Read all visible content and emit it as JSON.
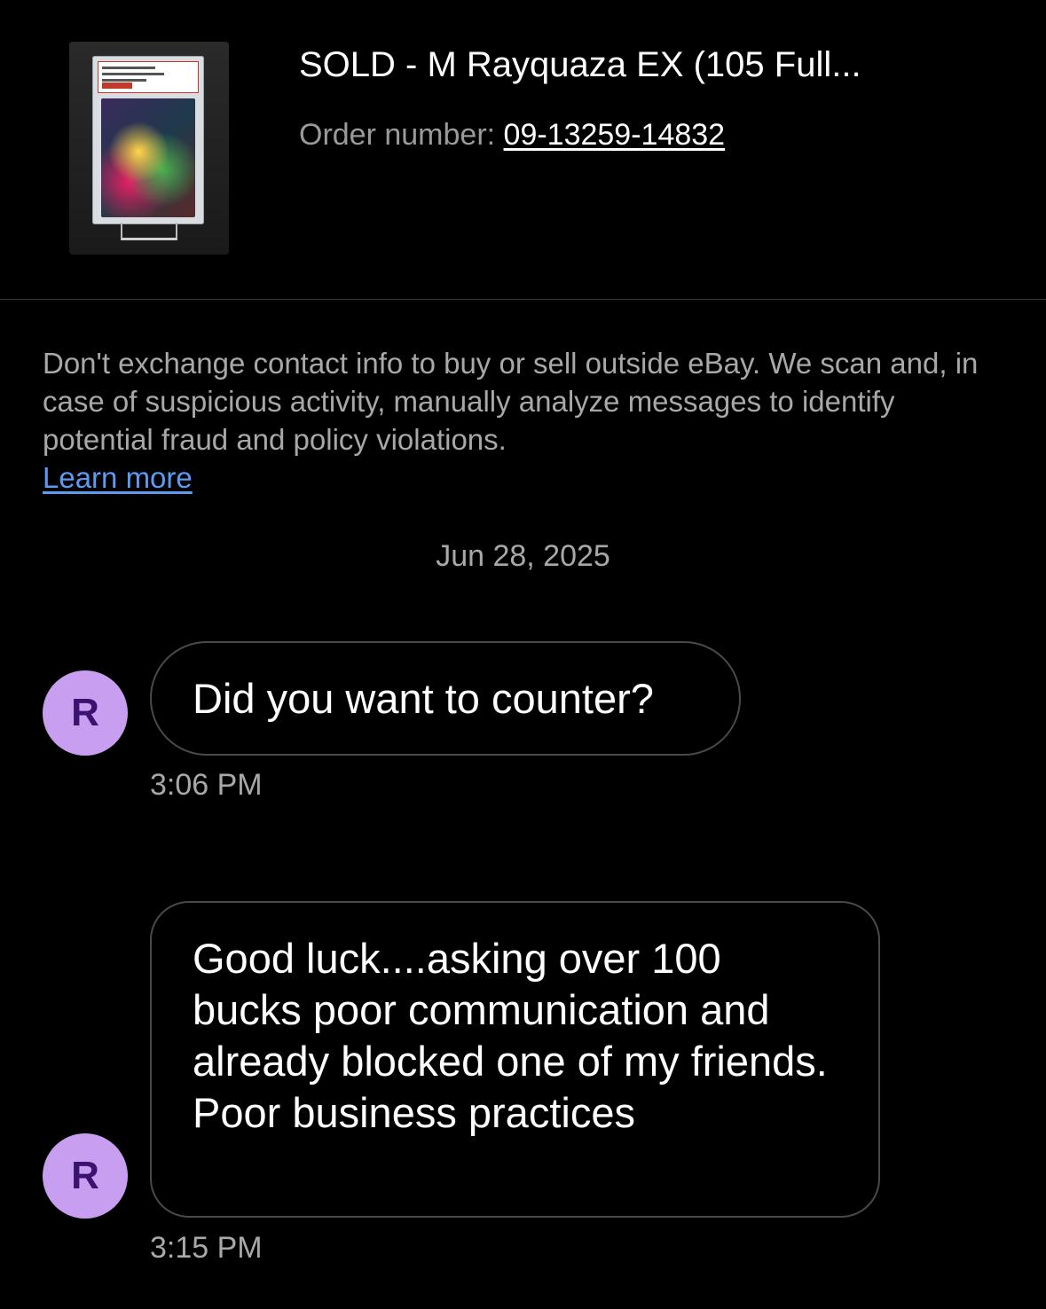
{
  "listing": {
    "title": "SOLD - M Rayquaza EX (105 Full...",
    "order_label": "Order number: ",
    "order_number": "09-13259-14832",
    "image_icon": "graded-card-photo"
  },
  "notice": {
    "text": "Don't exchange contact info to buy or sell outside eBay. We scan and, in case of suspicious activity, manually analyze messages to identify potential fraud and policy violations.",
    "link": "Learn more",
    "link_color": "#5b9cf2"
  },
  "date_separator": "Jun 28, 2025",
  "messages": [
    {
      "avatar_letter": "R",
      "text": "Did you want to counter?",
      "time": "3:06 PM"
    },
    {
      "avatar_letter": "R",
      "text": "Good luck....asking over 100 bucks poor communication and already blocked one of my friends. Poor business practices",
      "time": "3:15 PM"
    }
  ],
  "colors": {
    "background": "#000000",
    "avatar_bg": "#c89ff0",
    "avatar_text": "#3a1370",
    "bubble_border": "#4a4a4a",
    "muted_text": "#a8a8a8"
  }
}
